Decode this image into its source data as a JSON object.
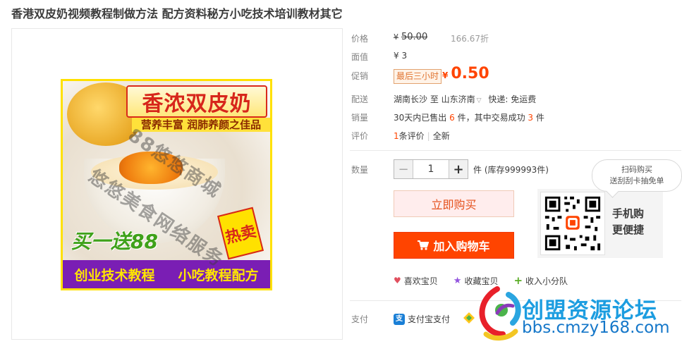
{
  "product": {
    "title": "香港双皮奶视频教程制做方法 配方资料秘方小吃技术培训教材其它"
  },
  "poster": {
    "banner": "香浓双皮奶",
    "subline": "营养丰富 润肺养颜之佳品",
    "promo": "买一送88",
    "hot_tag": "热卖",
    "footer_left": "创业技术教程",
    "footer_right": "小吃教程配方",
    "watermark_line1": "悠悠美食网络服务",
    "watermark_line2": "88悠悠商城"
  },
  "details": {
    "price_label": "价格",
    "currency": "¥",
    "original_price": "50.00",
    "discount": "166.67折",
    "face_label": "面值",
    "face_value": "¥ 3",
    "promo_label": "促销",
    "promo_tag": "最后三小时",
    "promo_price": "0.50",
    "ship_label": "配送",
    "ship_from": "湖南长沙 至",
    "ship_to": "山东济南",
    "ship_fee": "快递: 免运费",
    "sales_label": "销量",
    "sales_prefix": "30天内已售出",
    "sales_count": "6",
    "sales_mid": "件，其中交易成功",
    "sales_success": "3",
    "sales_suffix": "件",
    "review_label": "评价",
    "review_count": "1",
    "review_text": "条评价",
    "review_sep": "|",
    "review_new": "全新"
  },
  "purchase": {
    "qty_label": "数量",
    "qty_minus": "−",
    "qty_value": "1",
    "qty_plus": "+",
    "stock": "件 (库存999993件)",
    "buy_now": "立即购买",
    "add_cart": "加入购物车",
    "bubble_line1": "扫码购买",
    "bubble_line2": "送刮刮卡抽免单",
    "mobile_line1": "手机购",
    "mobile_line2": "更便捷"
  },
  "actions": {
    "favorite_item": "喜欢宝贝",
    "collect_item": "收藏宝贝",
    "join_team": "收入小分队"
  },
  "payment": {
    "label": "支付",
    "alipay": "支付宝支付",
    "alipay_glyph": "支"
  },
  "forum": {
    "name": "创盟资源论坛",
    "url": "bbs.cmzy168.com"
  },
  "colors": {
    "accent": "#ff4400",
    "buy_now_bg": "#ffeded",
    "poster_footer": "#7a1eb4",
    "forum_blue": "#1c9de0"
  },
  "icons": {
    "cart": "cart-icon",
    "heart": "heart-icon",
    "star": "star-icon",
    "plus": "plus-icon",
    "qr": "qr-code",
    "alipay": "alipay-icon"
  }
}
